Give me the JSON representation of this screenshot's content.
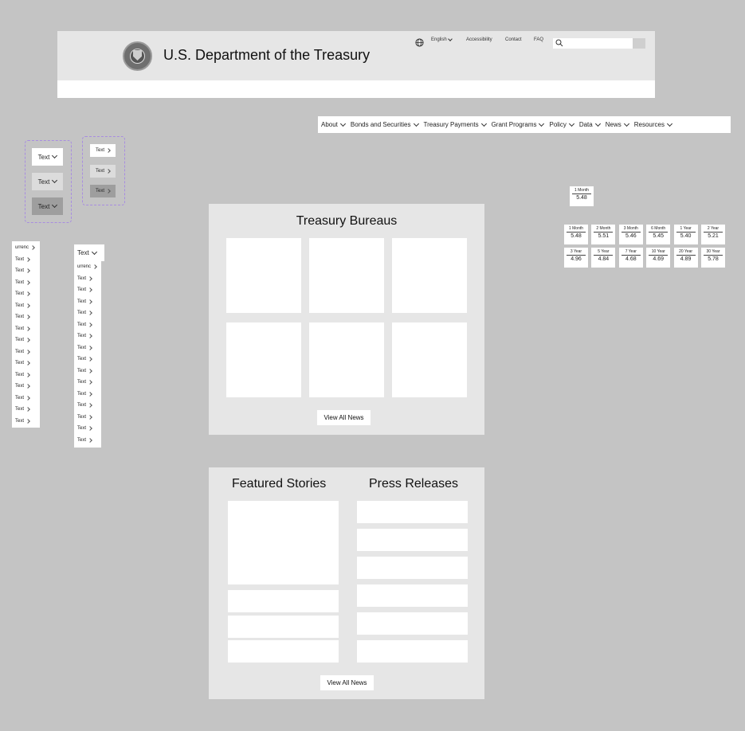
{
  "header": {
    "title": "U.S. Department of the Treasury",
    "language": "English",
    "links": [
      "Accessibility",
      "Contact",
      "FAQ"
    ],
    "search_placeholder": ""
  },
  "nav": {
    "items": [
      "About",
      "Bonds and Securities",
      "Treasury Payments",
      "Grant Programs",
      "Policy",
      "Data",
      "News",
      "Resources"
    ]
  },
  "dropdown_variants": [
    "Text",
    "Text",
    "Text"
  ],
  "link_variants": [
    "Text",
    "Text",
    "Text"
  ],
  "list_a": {
    "first": "urrenc",
    "items": [
      "Text",
      "Text",
      "Text",
      "Text",
      "Text",
      "Text",
      "Text",
      "Text",
      "Text",
      "Text",
      "Text",
      "Text",
      "Text",
      "Text",
      "Text"
    ]
  },
  "list_b": {
    "header": "Text",
    "first": "urrenc",
    "items": [
      "Text",
      "Text",
      "Text",
      "Text",
      "Text",
      "Text",
      "Text",
      "Text",
      "Text",
      "Text",
      "Text",
      "Text",
      "Text",
      "Text",
      "Text"
    ]
  },
  "rates_single": {
    "label": "1 Month",
    "value": "5.48"
  },
  "rates_grid": [
    {
      "label": "1 Month",
      "value": "5.48"
    },
    {
      "label": "2 Month",
      "value": "5.51"
    },
    {
      "label": "3 Month",
      "value": "5.46"
    },
    {
      "label": "6 Month",
      "value": "5.45"
    },
    {
      "label": "1 Year",
      "value": "5.40"
    },
    {
      "label": "2 Year",
      "value": "5.21"
    },
    {
      "label": "3 Year",
      "value": "4.96"
    },
    {
      "label": "5 Year",
      "value": "4.84"
    },
    {
      "label": "7 Year",
      "value": "4.68"
    },
    {
      "label": "10 Year",
      "value": "4.69"
    },
    {
      "label": "20 Year",
      "value": "4.89"
    },
    {
      "label": "30 Year",
      "value": "5.78"
    }
  ],
  "bureaus": {
    "title": "Treasury Bureaus",
    "button": "View All News"
  },
  "stories": {
    "featured_title": "Featured Stories",
    "press_title": "Press Releases",
    "button": "View All News"
  },
  "colors": {
    "background": "#c4c4c4",
    "panel": "#e6e6e6",
    "card": "#ffffff",
    "accent_dashed": "#a88de0"
  }
}
